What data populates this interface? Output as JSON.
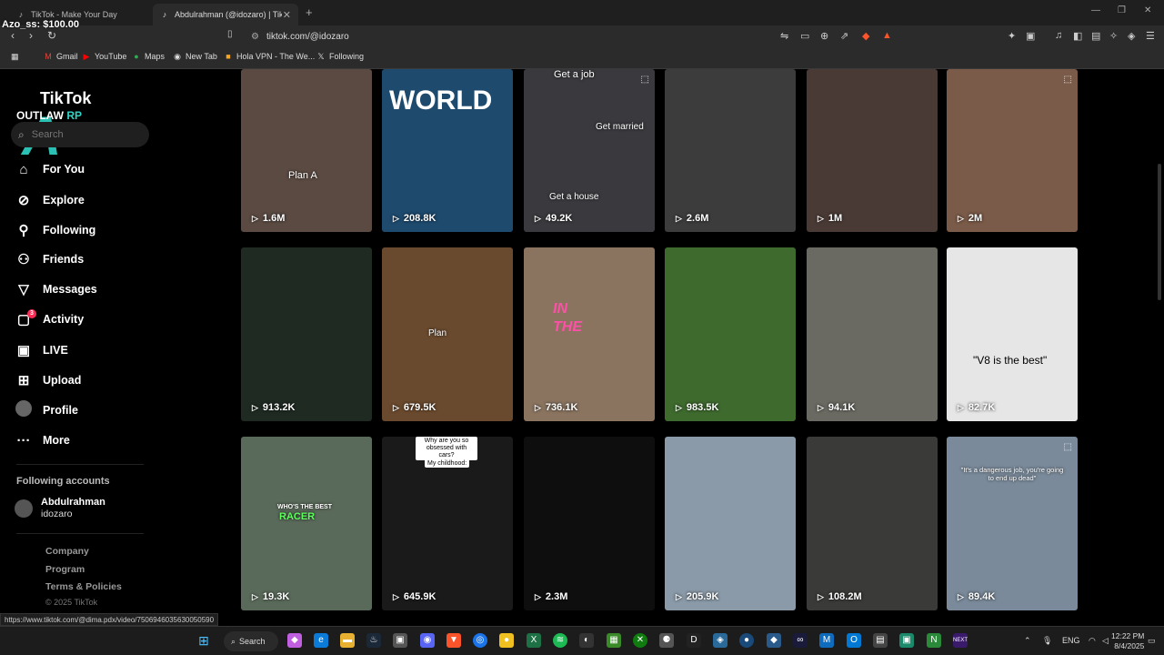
{
  "browser": {
    "tabs": [
      {
        "title": "TikTok - Make Your Day",
        "active": false
      },
      {
        "title": "Abdulrahman (@idozaro) | TikTo",
        "active": true
      }
    ],
    "url": "tiktok.com/@idozaro",
    "bookmarks": [
      "Gmail",
      "YouTube",
      "Maps",
      "New Tab",
      "Hola VPN - The We...",
      "Following"
    ]
  },
  "overlay": {
    "balance_text": "Azo_ss: $100.00"
  },
  "sidebar": {
    "logo_text": "TikTok",
    "logo_sub": "OUTLAW",
    "logo_sub_accent": "RP",
    "logo_letter": "A",
    "search_placeholder": "Search",
    "items": [
      {
        "label": "For You",
        "icon": "home-icon"
      },
      {
        "label": "Explore",
        "icon": "compass-icon"
      },
      {
        "label": "Following",
        "icon": "following-icon"
      },
      {
        "label": "Friends",
        "icon": "friends-icon"
      },
      {
        "label": "Messages",
        "icon": "send-icon"
      },
      {
        "label": "Activity",
        "icon": "activity-icon",
        "badge": "3"
      },
      {
        "label": "LIVE",
        "icon": "live-icon"
      },
      {
        "label": "Upload",
        "icon": "upload-icon"
      },
      {
        "label": "Profile",
        "icon": "profile-icon"
      },
      {
        "label": "More",
        "icon": "more-icon"
      }
    ],
    "following_title": "Following accounts",
    "account": {
      "name": "Abdulrahman",
      "handle": "idozaro"
    },
    "footer": [
      "Company",
      "Program",
      "Terms & Policies"
    ],
    "copyright": "© 2025 TikTok"
  },
  "videos": [
    {
      "views": "1.6M",
      "caption": "Plan A",
      "bg": "#5a4a42"
    },
    {
      "views": "208.8K",
      "caption": "WORLD",
      "bg": "#1e4a6e"
    },
    {
      "views": "49.2K",
      "caption": "Get a job",
      "caption2": "Get married",
      "caption3": "Get a house",
      "bg": "#3a3a3e"
    },
    {
      "views": "2.6M",
      "bg": "#3c3c3c"
    },
    {
      "views": "1M",
      "bg": "#4a3a35"
    },
    {
      "views": "2M",
      "bg": "#7a5a48"
    },
    {
      "views": "913.2K",
      "bg": "#1e2a22"
    },
    {
      "views": "679.5K",
      "caption": "Plan",
      "bg": "#6a4a2e"
    },
    {
      "views": "736.1K",
      "caption": "IN THE",
      "bg": "#8a7460"
    },
    {
      "views": "983.5K",
      "bg": "#3e6a2e"
    },
    {
      "views": "94.1K",
      "bg": "#6a6a62"
    },
    {
      "views": "82.7K",
      "caption": "\"V8 is the best\"",
      "bg": "#e6e6e6"
    },
    {
      "views": "19.3K",
      "caption": "WHO'S THE BEST",
      "caption2": "RACER",
      "bg": "#5a6a5a"
    },
    {
      "views": "645.9K",
      "caption": "Why are you so obsessed with cars?",
      "caption2": "My childhood:",
      "bg": "#1a1a1a"
    },
    {
      "views": "2.3M",
      "bg": "#0e0e0e"
    },
    {
      "views": "205.9K",
      "bg": "#8a9aa8"
    },
    {
      "views": "108.2M",
      "bg": "#3a3a38"
    },
    {
      "views": "89.4K",
      "caption": "\"It's a dangerous job, you're going to end up dead\"",
      "bg": "#7a8a9a"
    }
  ],
  "status_url": "https://www.tiktok.com/@dima.pdx/video/7506946035630050590",
  "taskbar": {
    "search_label": "Search",
    "lang": "ENG",
    "time": "12:22 PM",
    "date": "8/4/2025"
  }
}
